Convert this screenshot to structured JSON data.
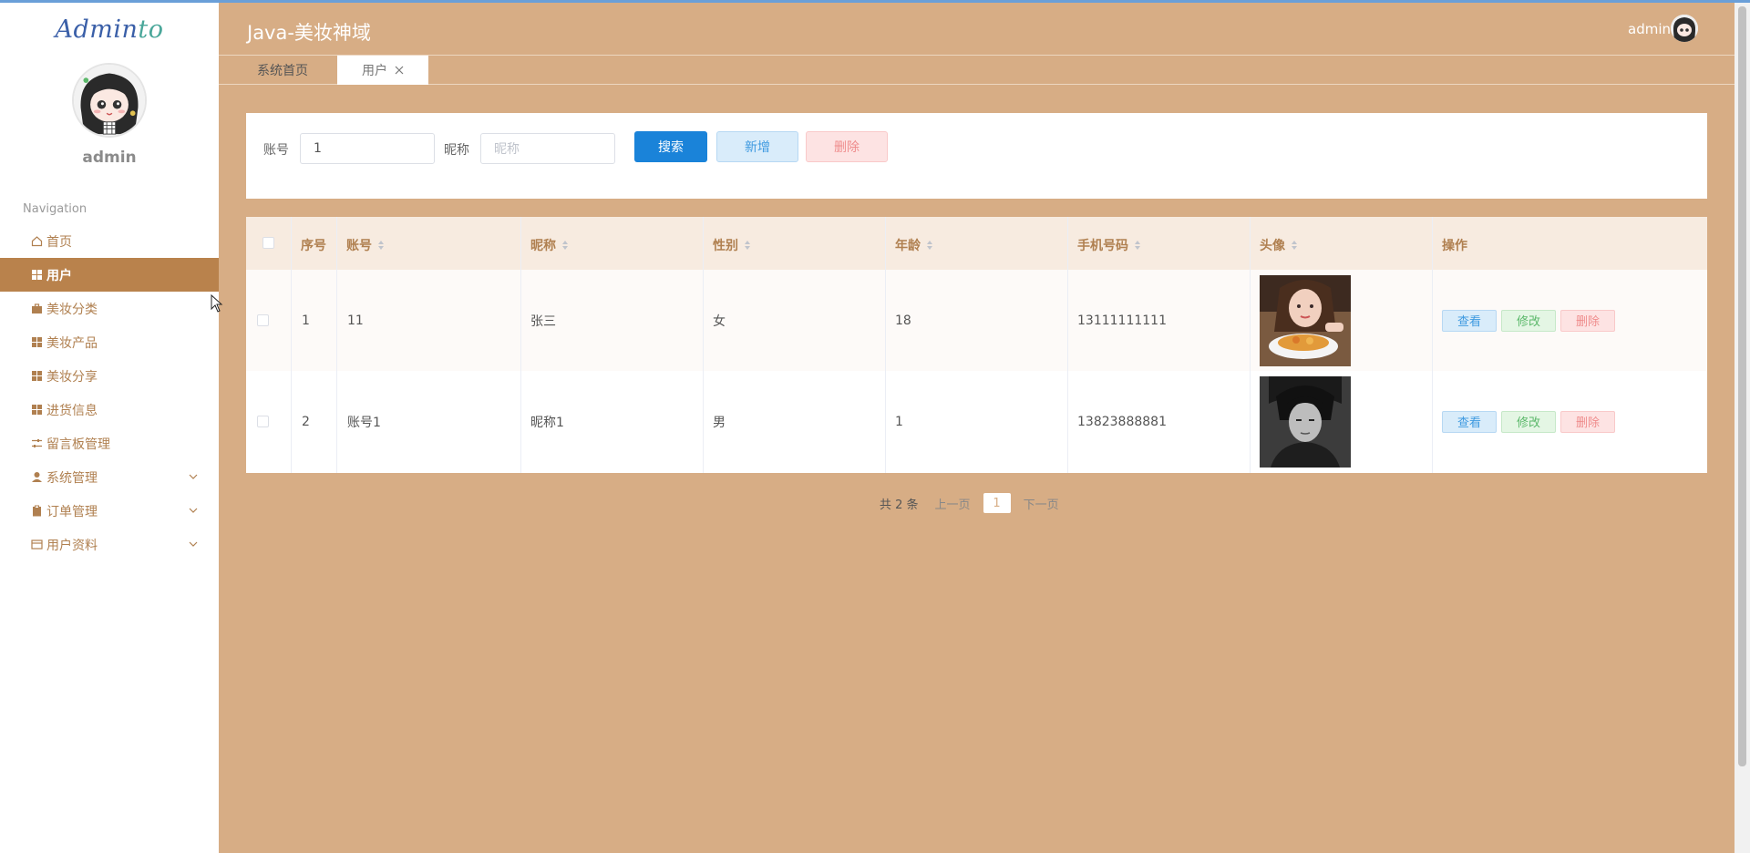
{
  "sidebar": {
    "logo_main": "Admin",
    "logo_suffix": "to",
    "username": "admin",
    "nav_title": "Navigation",
    "items": [
      {
        "label": "首页",
        "icon": "home-icon"
      },
      {
        "label": "用户",
        "icon": "grid-icon"
      },
      {
        "label": "美妆分类",
        "icon": "briefcase-icon"
      },
      {
        "label": "美妆产品",
        "icon": "grid-icon"
      },
      {
        "label": "美妆分享",
        "icon": "grid-icon"
      },
      {
        "label": "进货信息",
        "icon": "grid-icon"
      },
      {
        "label": "留言板管理",
        "icon": "sliders-icon"
      },
      {
        "label": "系统管理",
        "icon": "user-icon"
      },
      {
        "label": "订单管理",
        "icon": "clipboard-icon"
      },
      {
        "label": "用户资料",
        "icon": "card-icon"
      }
    ]
  },
  "header": {
    "title": "Java-美妆神域",
    "user": "admin"
  },
  "tabs": [
    {
      "label": "系统首页"
    },
    {
      "label": "用户"
    }
  ],
  "search": {
    "account_label": "账号",
    "account_value": "1",
    "nickname_label": "昵称",
    "nickname_placeholder": "昵称",
    "search_button": "搜索",
    "add_button": "新增",
    "delete_button": "删除"
  },
  "table": {
    "headers": [
      "序号",
      "账号",
      "昵称",
      "性别",
      "年龄",
      "手机号码",
      "头像",
      "操作"
    ],
    "rows": [
      {
        "index": "1",
        "account": "11",
        "nickname": "张三",
        "gender": "女",
        "age": "18",
        "phone": "13111111111"
      },
      {
        "index": "2",
        "account": "账号1",
        "nickname": "昵称1",
        "gender": "男",
        "age": "1",
        "phone": "13823888881"
      }
    ],
    "actions": {
      "view": "查看",
      "edit": "修改",
      "remove": "删除"
    }
  },
  "pagination": {
    "total": "共 2 条",
    "prev": "上一页",
    "current": "1",
    "next": "下一页"
  },
  "colors": {
    "background": "#d7ad85",
    "active_nav": "#b9824c",
    "primary": "#1a83d9"
  }
}
